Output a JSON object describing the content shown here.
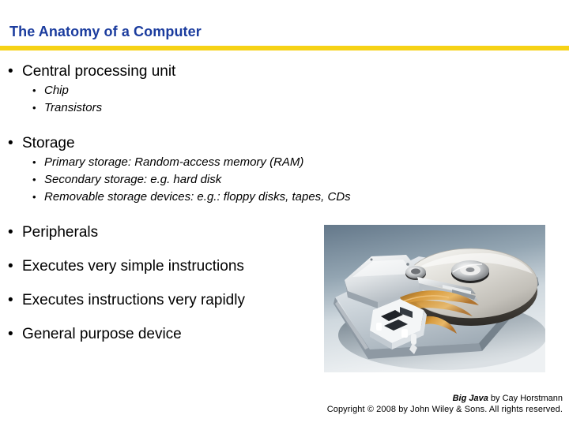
{
  "slide": {
    "title": "The Anatomy of a Computer",
    "accent_rule_color": "#f6d216",
    "title_color": "#1b3c9e",
    "background_color": "#ffffff",
    "bullet_marker": "•"
  },
  "content": {
    "groups": [
      {
        "id": "cpu",
        "main": "Central processing unit",
        "subs": [
          "Chip",
          "Transistors"
        ]
      },
      {
        "id": "storage",
        "main": "Storage",
        "subs": [
          "Primary storage: Random-access memory (RAM)",
          "Secondary storage: e.g. hard disk",
          "Removable storage devices: e.g.: floppy disks, tapes, CDs"
        ]
      },
      {
        "id": "rest",
        "items": [
          "Peripherals",
          "Executes very simple instructions",
          "Executes instructions very rapidly",
          "General purpose device"
        ]
      }
    ]
  },
  "image": {
    "name": "hard-disk-drive-photo",
    "description": "Open hard disk drive showing platter, spindle hub, actuator arm and ribbon cable",
    "colors": {
      "background_top": "#6d7f8d",
      "background_bottom": "#e8ecef",
      "chassis": "#c9d0d6",
      "platter": "#d9d9d6",
      "ribbon": "#c98a34",
      "shadow": "#4d5d6a"
    }
  },
  "footer": {
    "book_title": "Big Java",
    "byline": " by Cay Horstmann",
    "copyright": "Copyright © 2008 by John Wiley & Sons.  All rights reserved."
  }
}
